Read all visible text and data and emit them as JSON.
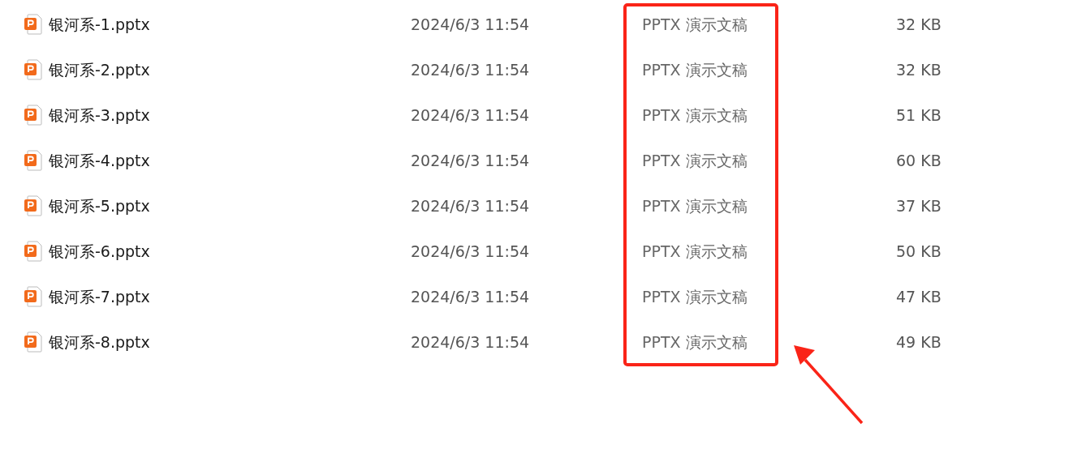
{
  "files": [
    {
      "name": "银河系-1.pptx",
      "modified": "2024/6/3 11:54",
      "type": "PPTX 演示文稿",
      "size": "32 KB"
    },
    {
      "name": "银河系-2.pptx",
      "modified": "2024/6/3 11:54",
      "type": "PPTX 演示文稿",
      "size": "32 KB"
    },
    {
      "name": "银河系-3.pptx",
      "modified": "2024/6/3 11:54",
      "type": "PPTX 演示文稿",
      "size": "51 KB"
    },
    {
      "name": "银河系-4.pptx",
      "modified": "2024/6/3 11:54",
      "type": "PPTX 演示文稿",
      "size": "60 KB"
    },
    {
      "name": "银河系-5.pptx",
      "modified": "2024/6/3 11:54",
      "type": "PPTX 演示文稿",
      "size": "37 KB"
    },
    {
      "name": "银河系-6.pptx",
      "modified": "2024/6/3 11:54",
      "type": "PPTX 演示文稿",
      "size": "50 KB"
    },
    {
      "name": "银河系-7.pptx",
      "modified": "2024/6/3 11:54",
      "type": "PPTX 演示文稿",
      "size": "47 KB"
    },
    {
      "name": "银河系-8.pptx",
      "modified": "2024/6/3 11:54",
      "type": "PPTX 演示文稿",
      "size": "49 KB"
    }
  ]
}
